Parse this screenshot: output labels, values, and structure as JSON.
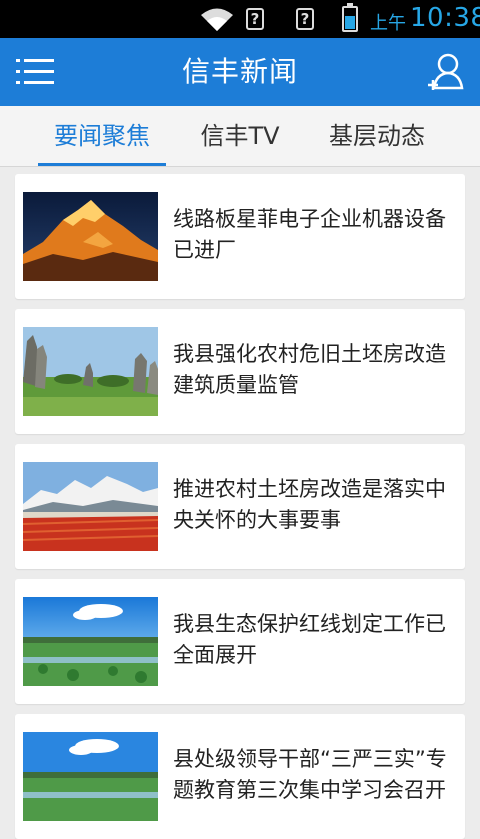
{
  "statusbar": {
    "ampm": "上午",
    "time": "10:38",
    "icons": [
      "wifi-icon",
      "signal-unknown-icon",
      "signal-unknown-icon",
      "battery-charging-icon"
    ]
  },
  "appbar": {
    "title": "信丰新闻",
    "left_icon": "menu-icon",
    "right_icon": "user-add-icon",
    "color": "#1d7dd7"
  },
  "tabs": [
    {
      "label": "要闻聚焦",
      "active": true
    },
    {
      "label": "信丰TV",
      "active": false
    },
    {
      "label": "基层动态",
      "active": false
    }
  ],
  "news": [
    {
      "headline": "线路板星菲电子企业机器设备已进厂",
      "thumbnail": "snow-mountain-sunset-image"
    },
    {
      "headline": "我县强化农村危旧土坯房改造建筑质量监管",
      "thumbnail": "stone-forest-image"
    },
    {
      "headline": "推进农村土坯房改造是落实中央关怀的大事要事",
      "thumbnail": "snow-mountain-red-field-image"
    },
    {
      "headline": "我县生态保护红线划定工作已全面展开",
      "thumbnail": "lotus-lake-image"
    },
    {
      "headline": "县处级领导干部“三严三实”专题教育第三次集中学习会召开",
      "thumbnail": "lotus-lake-image"
    }
  ]
}
